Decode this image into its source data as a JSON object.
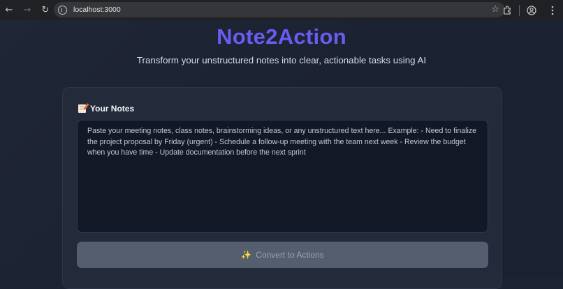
{
  "browser": {
    "url": "localhost:3000",
    "icons": [
      "back-arrow-icon",
      "forward-arrow-icon",
      "reload-icon",
      "site-info-icon",
      "bookmark-star-icon",
      "extensions-icon",
      "profile-icon",
      "menu-dots-icon"
    ]
  },
  "app": {
    "title": "Note2Action",
    "subtitle": "Transform your unstructured notes into clear, actionable tasks using AI",
    "accent_color": "#6a5cf0"
  },
  "notes": {
    "label": "Your Notes",
    "label_icon": "memo-icon",
    "placeholder": "Paste your meeting notes, class notes, brainstorming ideas, or any unstructured text here... Example: - Need to finalize the project proposal by Friday (urgent) - Schedule a follow-up meeting with the team next week - Review the budget when you have time - Update documentation before the next sprint",
    "value": ""
  },
  "actions": {
    "convert_label": "Convert to Actions",
    "convert_icon": "sparkle-icon",
    "convert_enabled": false
  }
}
